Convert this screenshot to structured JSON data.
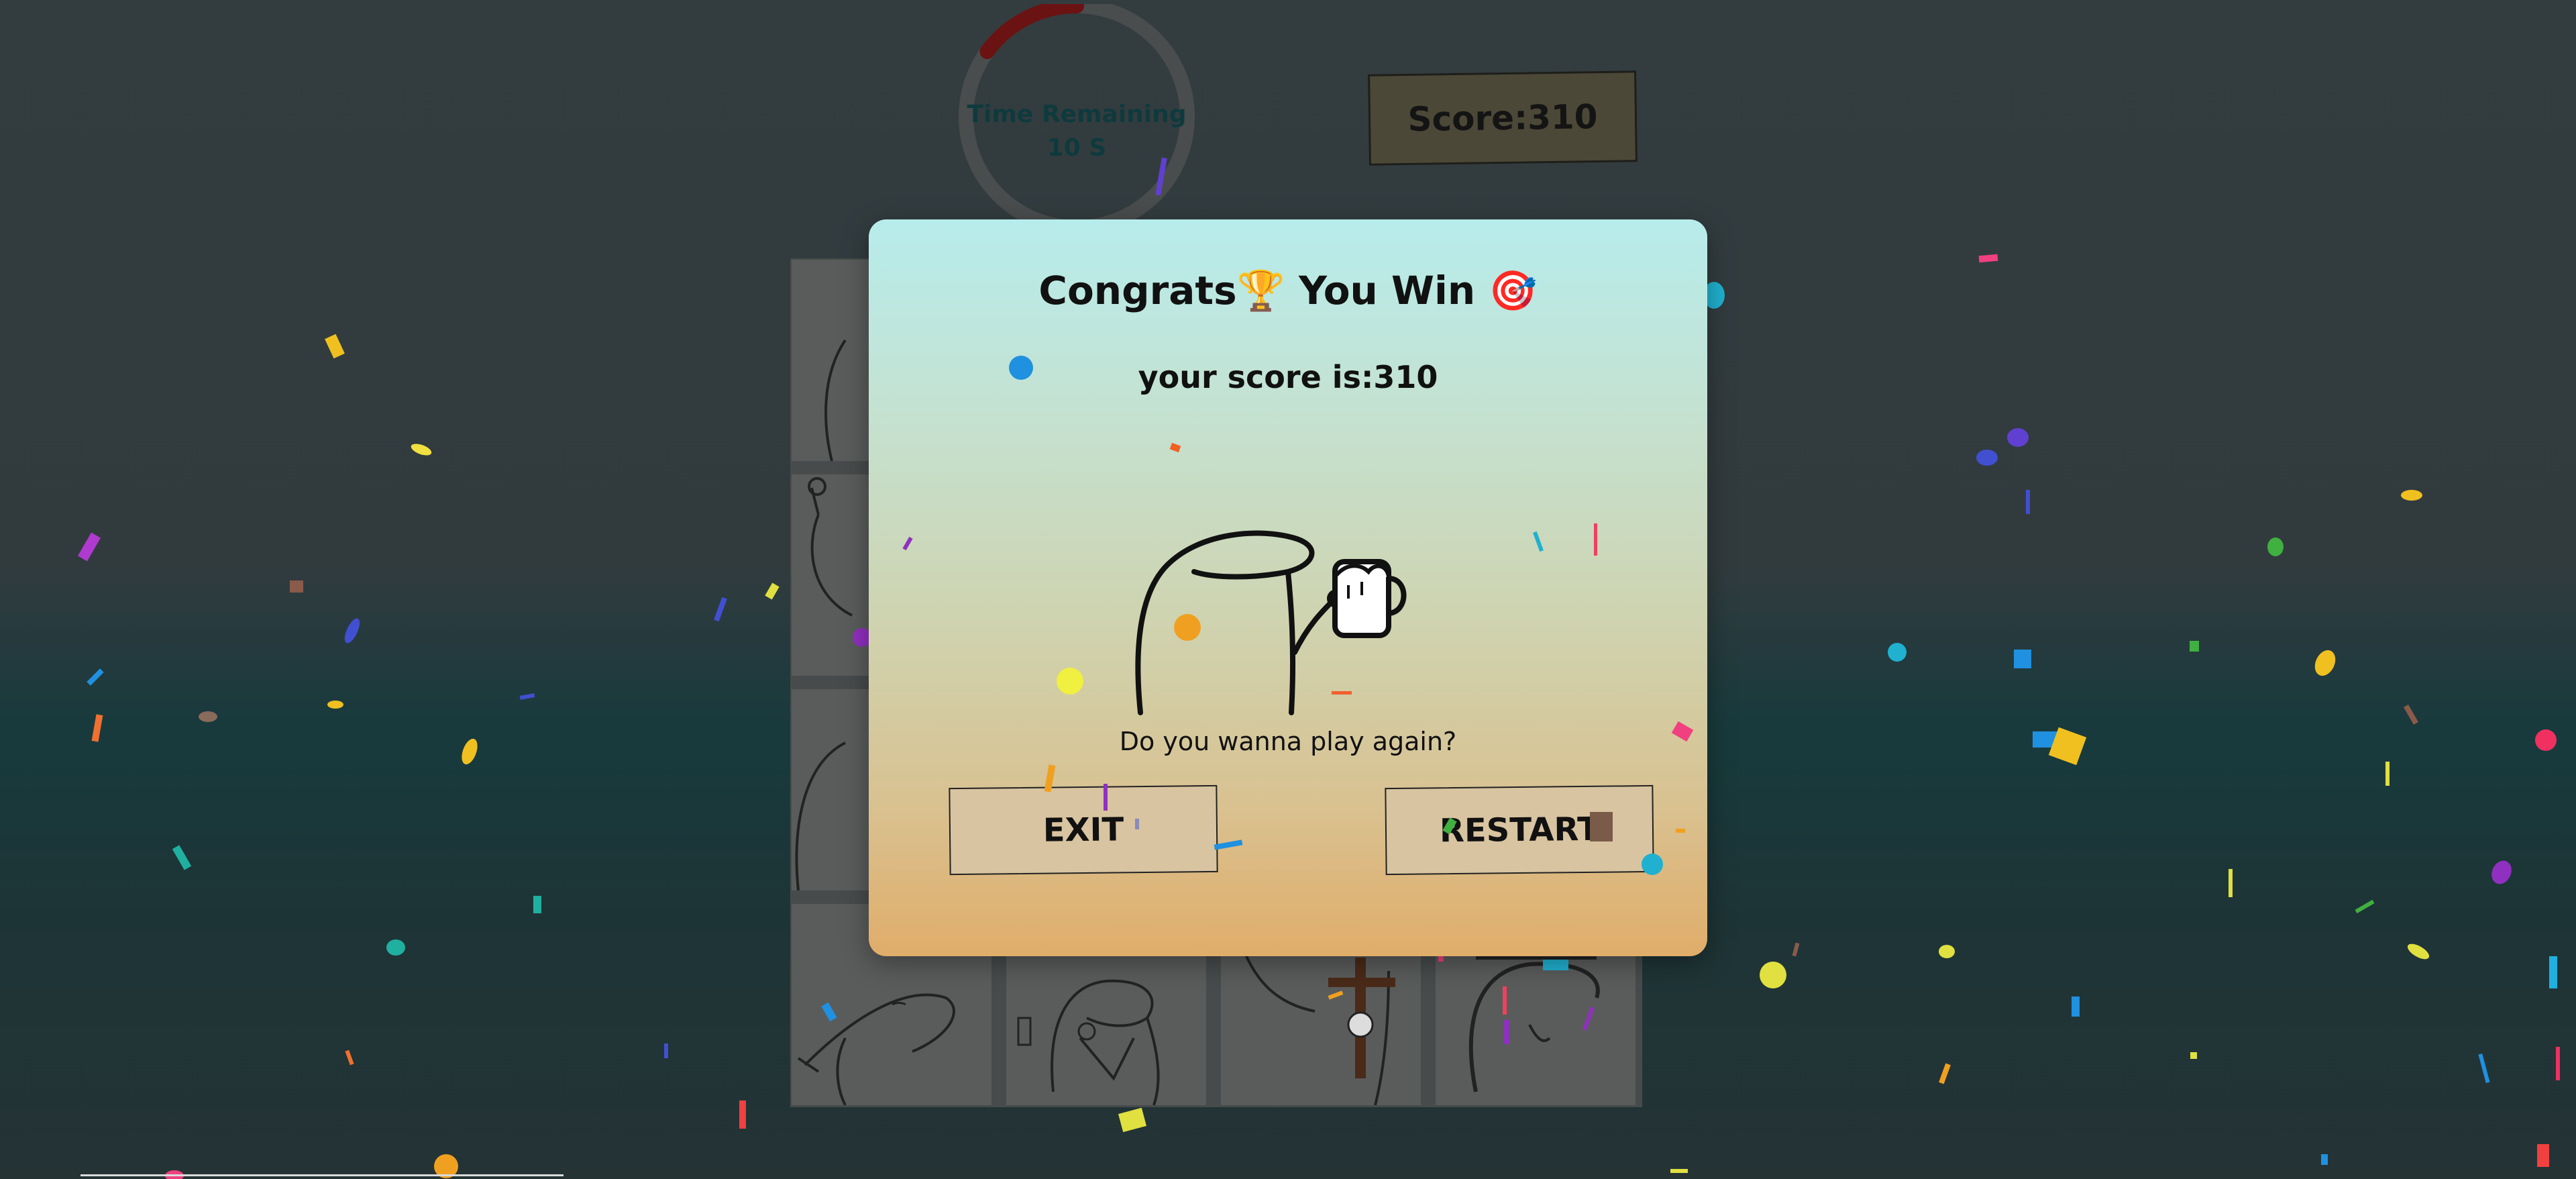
{
  "timer": {
    "label": "Time Remaining",
    "value": "10 S",
    "remaining_fraction": 0.15,
    "ring_color": "#6b1212",
    "track_color": "#4c4c4c"
  },
  "score_display": {
    "text": "Score:310"
  },
  "modal": {
    "title_prefix": "Congrats",
    "title_trophy": "🏆",
    "title_middle": "You Win",
    "title_target": "🎯",
    "score_text": "your score is:310",
    "question": "Do you wanna play again?",
    "exit_label": "EXIT",
    "restart_label": "RESTART"
  },
  "colors": {
    "modal_top": "#b7ecec",
    "modal_bottom": "#e0ad6a",
    "button_bg": "#d8c4a0",
    "board_bg": "#474b4b"
  }
}
